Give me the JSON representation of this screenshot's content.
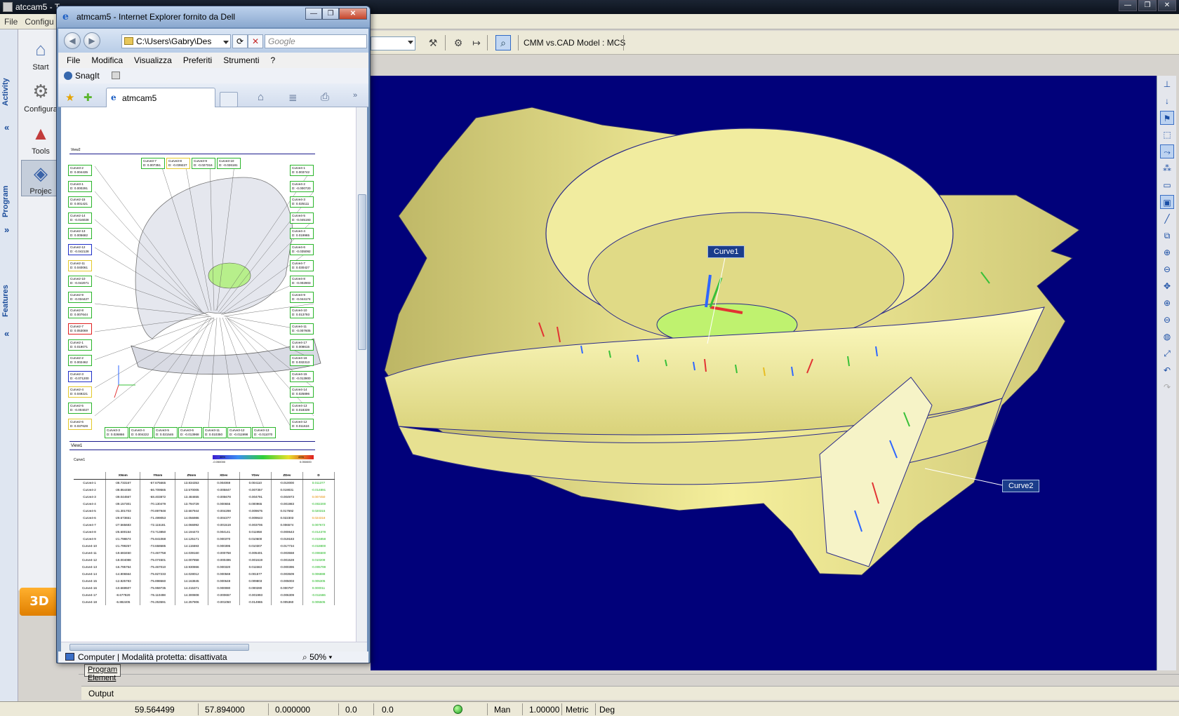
{
  "app": {
    "title": "atccam5 - T",
    "menu": [
      "File",
      "Configu"
    ],
    "window_controls": [
      "—",
      "❐",
      "✕"
    ]
  },
  "toolbar": {
    "cmm_label": "CMM vs.CAD Model :",
    "cmm_value": "MCS"
  },
  "left_strip": {
    "tabs": [
      "Activity",
      "Program",
      "Features"
    ]
  },
  "left_tools": [
    {
      "label": "Start",
      "icon": "start-icon"
    },
    {
      "label": "Configura",
      "icon": "configure-icon"
    },
    {
      "label": "Tools",
      "icon": "tools-icon"
    },
    {
      "label": "Projec",
      "icon": "project-icon"
    }
  ],
  "badge_3d": "3D",
  "ie": {
    "title": "atmcam5 - Internet Explorer fornito da Dell",
    "address": "C:\\Users\\Gabry\\Des",
    "search_placeholder": "Google",
    "menu": [
      "File",
      "Modifica",
      "Visualizza",
      "Preferiti",
      "Strumenti",
      "?"
    ],
    "links_snagit": "SnagIt",
    "tab_label": "atmcam5",
    "status_text": "Computer | Modalità protetta: disattivata",
    "zoom": "50%"
  },
  "report": {
    "view2_label": "View2",
    "view1_label": "View1",
    "curve1_label": "Curve1",
    "legend_left": "-0.050000",
    "legend_right": "0.050000",
    "legend_left_pct": "46%",
    "legend_right_pct": "43%",
    "top_boxes": [
      {
        "name": "Curve3-7",
        "val": "D: 0.007351"
      },
      {
        "name": "Curve3-8",
        "val": "D: -0.039227"
      },
      {
        "name": "Curve3-9",
        "val": "D: -0.027316"
      },
      {
        "name": "Curve3-10",
        "val": "D: -0.026181"
      }
    ],
    "left_boxes": [
      {
        "name": "Curve3-2",
        "val": "D: 0.004435"
      },
      {
        "name": "Curve3-1",
        "val": "D: 0.000291"
      },
      {
        "name": "Curve2-15",
        "val": "D: 0.001421"
      },
      {
        "name": "Curve2-14",
        "val": "D: -0.016028"
      },
      {
        "name": "Curve2-13",
        "val": "D: 0.005682"
      },
      {
        "name": "Curve2-12",
        "val": "D: -0.042128"
      },
      {
        "name": "Curve2-11",
        "val": "D: 0.040061"
      },
      {
        "name": "Curve2-10",
        "val": "D: -0.042071"
      },
      {
        "name": "Curve2-9",
        "val": "D: -0.034427"
      },
      {
        "name": "Curve2-8",
        "val": "D: 0.007644"
      },
      {
        "name": "Curve2-7",
        "val": "D: 0.053069"
      },
      {
        "name": "Curve2-1",
        "val": "D: 0.019071"
      },
      {
        "name": "Curve2-2",
        "val": "D: 0.002462"
      },
      {
        "name": "Curve2-3",
        "val": "D: -0.071200"
      },
      {
        "name": "Curve2-4",
        "val": "D: 0.049221"
      },
      {
        "name": "Curve2-5",
        "val": "D: -0.004027"
      },
      {
        "name": "Curve2-6",
        "val": "D: 0.037628"
      }
    ],
    "right_boxes": [
      {
        "name": "Curve4-1",
        "val": "D: 0.003742"
      },
      {
        "name": "Curve4-2",
        "val": "D: -0.000720"
      },
      {
        "name": "Curve4-3",
        "val": "D: 0.025111"
      },
      {
        "name": "Curve4-5",
        "val": "D: -0.045193"
      },
      {
        "name": "Curve4-4",
        "val": "D: 0.019965"
      },
      {
        "name": "Curve4-6",
        "val": "D: -0.035092"
      },
      {
        "name": "Curve4-7",
        "val": "D: 0.030427"
      },
      {
        "name": "Curve4-8",
        "val": "D: -0.002903"
      },
      {
        "name": "Curve4-9",
        "val": "D: -0.044174"
      },
      {
        "name": "Curve4-10",
        "val": "D: 0.013793"
      },
      {
        "name": "Curve4-11",
        "val": "D: -0.007605"
      },
      {
        "name": "Curve4-17",
        "val": "D: 0.008615"
      },
      {
        "name": "Curve4-16",
        "val": "D: 0.032313"
      },
      {
        "name": "Curve4-15",
        "val": "D: -0.013900"
      },
      {
        "name": "Curve4-14",
        "val": "D: 0.025896"
      },
      {
        "name": "Curve4-13",
        "val": "D: 0.018339"
      },
      {
        "name": "Curve4-12",
        "val": "D: 0.011624"
      }
    ],
    "bottom_boxes": [
      {
        "name": "Curve3-3",
        "val": "D: 0.026866"
      },
      {
        "name": "Curve3-4",
        "val": "D: 0.004222"
      },
      {
        "name": "Curve3-5",
        "val": "D: 0.021546"
      },
      {
        "name": "Curve3-6",
        "val": "D: -0.013968"
      },
      {
        "name": "Curve3-11",
        "val": "D: 0.010350"
      },
      {
        "name": "Curve3-12",
        "val": "D: -0.011998"
      },
      {
        "name": "Curve3-13",
        "val": "D: -0.011070"
      }
    ],
    "table": {
      "headers": [
        "",
        "XNom",
        "YNom",
        "ZNom",
        "XDev",
        "YDev",
        "ZDev",
        "D"
      ],
      "rows": [
        [
          "Curve4-1",
          "-38.733167",
          "-67.675665",
          "13.834353",
          "0.004069",
          "0.004110",
          "-0.010000",
          "0.011377",
          "g"
        ],
        [
          "Curve4-2",
          "-38.864458",
          "-66.709565",
          "13.570005",
          "-0.005847",
          "-0.007357",
          "0.019031",
          "-0.014891",
          "g"
        ],
        [
          "Curve4-3",
          "-39.044567",
          "-68.403872",
          "13.484655",
          "-0.005678",
          "-0.004791",
          "-0.004973",
          "0.007450",
          "o"
        ],
        [
          "Curve4-4",
          "-39.157301",
          "-70.130479",
          "13.794729",
          "0.000655",
          "0.000965",
          "-0.001983",
          "-0.002200",
          "g"
        ],
        [
          "Curve4-5",
          "-31.301703",
          "-70.897948",
          "13.667944",
          "-0.004298",
          "-0.009675",
          "0.017692",
          "0.020315",
          "g"
        ],
        [
          "Curve4-6",
          "-29.673651",
          "-71.499053",
          "14.056986",
          "-0.004377",
          "-0.009643",
          "0.022303",
          "0.024318",
          "o"
        ],
        [
          "Curve4-7",
          "-27.565683",
          "-72.115181",
          "14.066992",
          "-0.001519",
          "-0.003706",
          "0.006574",
          "0.007672",
          "g"
        ],
        [
          "Curve4-8",
          "-25.600154",
          "-73.713850",
          "14.194473",
          "0.004141",
          "0.011958",
          "-0.000643",
          "-0.014378",
          "g"
        ],
        [
          "Curve4-9",
          "-21.798674",
          "-75.841068",
          "14.125171",
          "0.000370",
          "0.010600",
          "-0.019183",
          "-0.015858",
          "g"
        ],
        [
          "Curve4-10",
          "-21.799257",
          "-73.658685",
          "14.115593",
          "0.000395",
          "0.010307",
          "-0.017734",
          "-0.018800",
          "g"
        ],
        [
          "Curve4-11",
          "-19.683450",
          "-74.467758",
          "14.039160",
          "-0.000758",
          "-0.005401",
          "-0.003558",
          "-0.006500",
          "g"
        ],
        [
          "Curve4-12",
          "-18.004088",
          "-75.074501",
          "14.007858",
          "-0.000496",
          "-0.001619",
          "-0.001528",
          "0.010209",
          "g"
        ],
        [
          "Curve4-13",
          "-16.795754",
          "-75.467010",
          "13.930866",
          "0.000320",
          "0.011563",
          "-0.000396",
          "-0.005799",
          "g"
        ],
        [
          "Curve4-14",
          "-14.806564",
          "-75.827233",
          "14.028012",
          "0.000569",
          "0.001577",
          "-0.003509",
          "0.006888",
          "g"
        ],
        [
          "Curve4-15",
          "-12.825783",
          "-75.898660",
          "14.163845",
          "0.000648",
          "0.009803",
          "-0.005003",
          "0.005305",
          "g"
        ],
        [
          "Curve4-16",
          "-10.669507",
          "-75.959735",
          "14.215371",
          "0.000080",
          "0.000280",
          "0.000787",
          "0.000011",
          "g"
        ],
        [
          "Curve4-17",
          "-8.677820",
          "-76.110498",
          "14.300808",
          "-0.000657",
          "-0.001993",
          "-0.006309",
          "-0.011586",
          "g"
        ],
        [
          "Curve4-18",
          "-6.882405",
          "-76.253591",
          "14.257906",
          "-0.001050",
          "-0.014965",
          "0.005360",
          "0.005505",
          "g"
        ]
      ]
    }
  },
  "viewport": {
    "callout1": "Curve1",
    "callout2": "Curve2"
  },
  "bottom": {
    "tab_label": "Program Element",
    "output_label": "Output"
  },
  "status": {
    "x": "59.564499",
    "y": "57.894000",
    "z": "0.000000",
    "a": "0.0",
    "b": "0.0",
    "mode": "Man",
    "scale": "1.00000",
    "units": "Metric",
    "angle": "Deg"
  }
}
